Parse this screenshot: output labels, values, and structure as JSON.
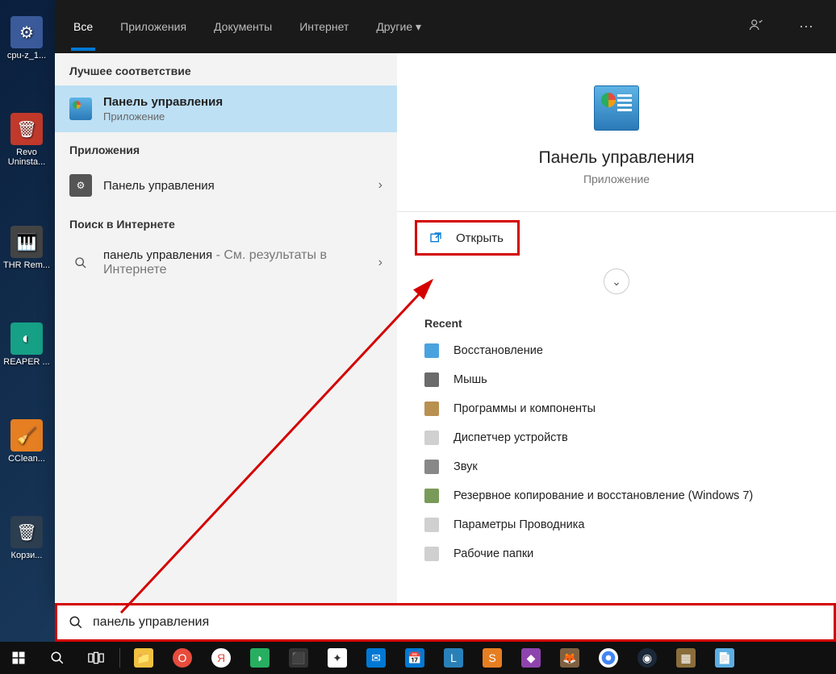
{
  "desktop_icons": [
    {
      "label": "cpu-z_1..."
    },
    {
      "label": "Revo Uninsta..."
    },
    {
      "label": "THR Rem..."
    },
    {
      "label": "REAPER ..."
    },
    {
      "label": "CClean..."
    },
    {
      "label": "Корзи..."
    }
  ],
  "header": {
    "tabs": [
      "Все",
      "Приложения",
      "Документы",
      "Интернет",
      "Другие"
    ],
    "active_tab": 0
  },
  "left": {
    "best_match_label": "Лучшее соответствие",
    "best_match": {
      "title": "Панель управления",
      "sub": "Приложение"
    },
    "apps_label": "Приложения",
    "apps": [
      {
        "title": "Панель управления"
      }
    ],
    "web_label": "Поиск в Интернете",
    "web": [
      {
        "title": "панель управления",
        "sub": " - См. результаты в Интернете"
      }
    ]
  },
  "right": {
    "title": "Панель управления",
    "sub": "Приложение",
    "open_label": "Открыть",
    "recent_label": "Recent",
    "recent": [
      {
        "label": "Восстановление",
        "color": "#4aa3df"
      },
      {
        "label": "Мышь",
        "color": "#6b6b6b"
      },
      {
        "label": "Программы и компоненты",
        "color": "#b89050"
      },
      {
        "label": "Диспетчер устройств",
        "color": "#d0d0d0"
      },
      {
        "label": "Звук",
        "color": "#888"
      },
      {
        "label": "Резервное копирование и восстановление (Windows 7)",
        "color": "#7a9a5a"
      },
      {
        "label": "Параметры Проводника",
        "color": "#d0d0d0"
      },
      {
        "label": "Рабочие папки",
        "color": "#d0d0d0"
      }
    ]
  },
  "search_value": "панель управления",
  "taskbar_apps": [
    "start",
    "search",
    "taskview",
    "explorer",
    "opera",
    "yandex",
    "sputnik",
    "app1",
    "app2",
    "mail",
    "calendar",
    "lister",
    "sublime",
    "git",
    "gimp",
    "chrome",
    "steam",
    "explorer2",
    "notepad"
  ]
}
